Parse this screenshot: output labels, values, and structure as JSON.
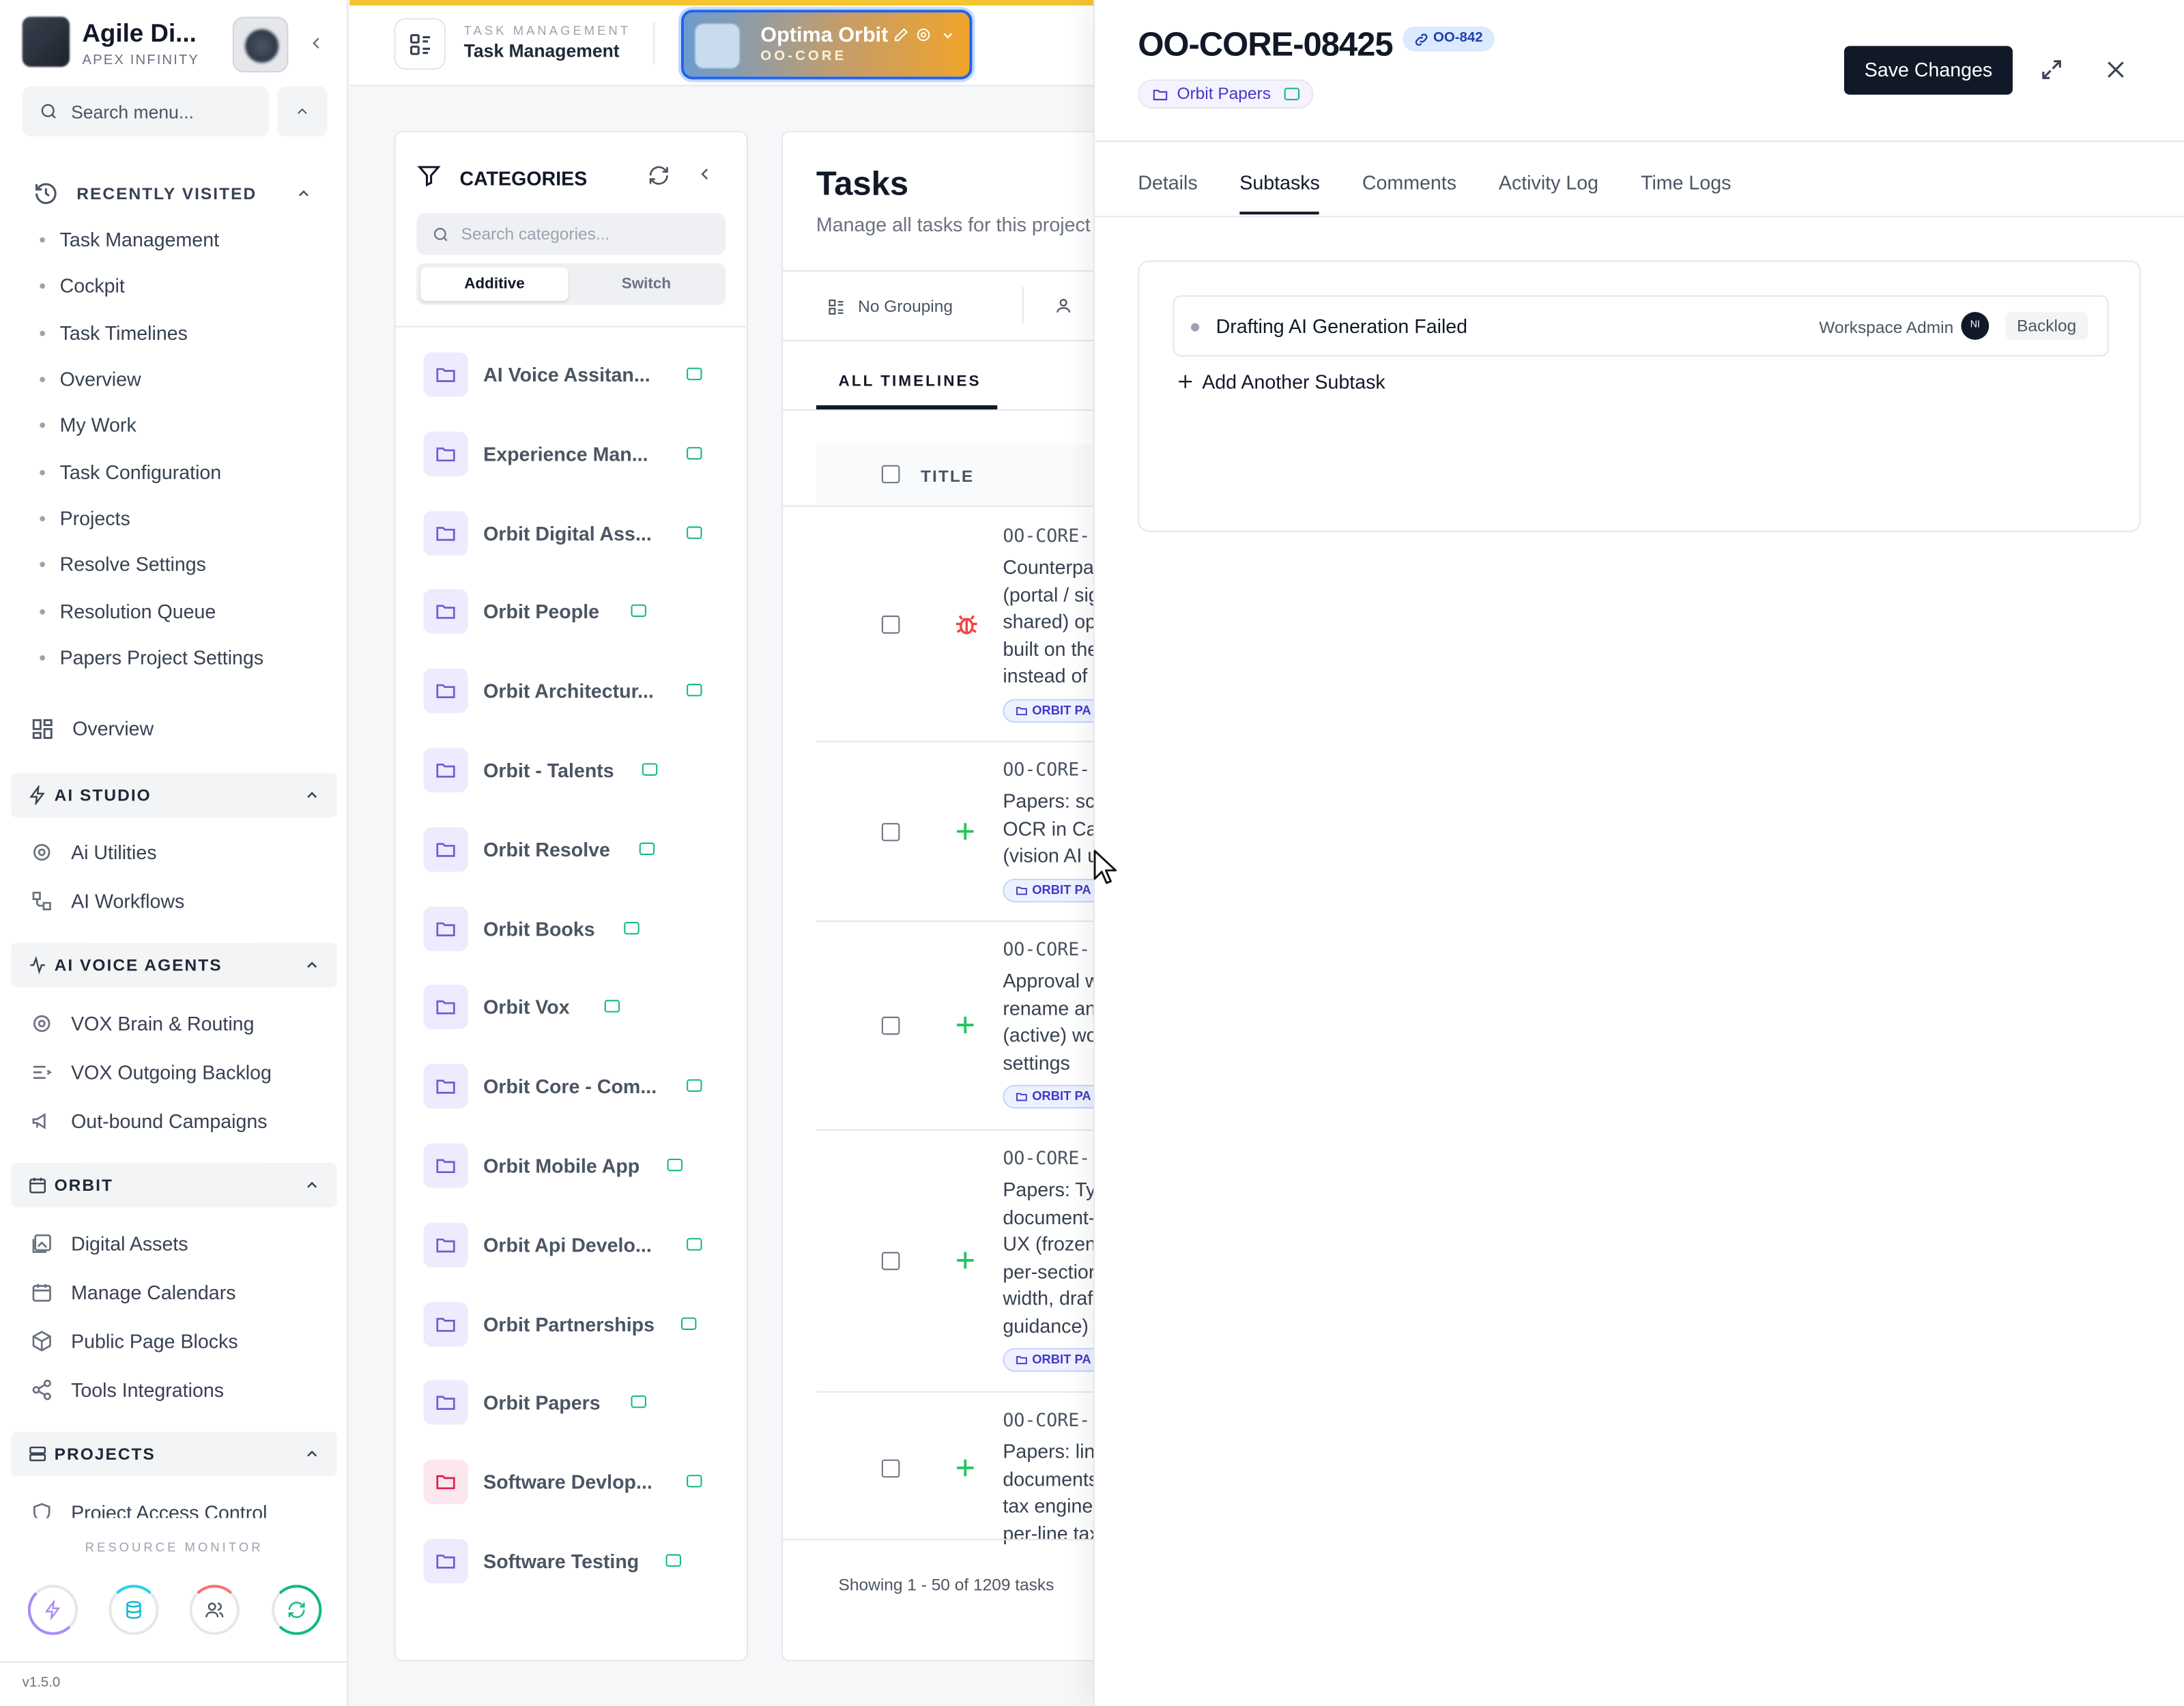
{
  "sidebar": {
    "app_title": "Agile Di...",
    "app_subtitle": "APEX INFINITY",
    "search_placeholder": "Search menu...",
    "recently_visited": {
      "label": "RECENTLY VISITED",
      "items": [
        "Task Management",
        "Cockpit",
        "Task Timelines",
        "Overview",
        "My Work",
        "Task Configuration",
        "Projects",
        "Resolve Settings",
        "Resolution Queue",
        "Papers Project Settings"
      ]
    },
    "overview_label": "Overview",
    "groups": [
      {
        "label": "AI STUDIO",
        "items": [
          {
            "label": "Ai Utilities",
            "icon": "gear-icon"
          },
          {
            "label": "AI Workflows",
            "icon": "workflow-icon"
          }
        ]
      },
      {
        "label": "AI VOICE AGENTS",
        "items": [
          {
            "label": "VOX Brain & Routing",
            "icon": "gear-icon"
          },
          {
            "label": "VOX Outgoing Backlog",
            "icon": "list-icon"
          },
          {
            "label": "Out-bound Campaigns",
            "icon": "megaphone-icon"
          }
        ]
      },
      {
        "label": "ORBIT",
        "items": [
          {
            "label": "Digital Assets",
            "icon": "image-icon"
          },
          {
            "label": "Manage Calendars",
            "icon": "calendar-icon"
          },
          {
            "label": "Public Page Blocks",
            "icon": "cube-icon"
          },
          {
            "label": "Tools Integrations",
            "icon": "share-icon"
          }
        ]
      },
      {
        "label": "PROJECTS",
        "items": [
          {
            "label": "Project Access Control",
            "icon": "shield-icon"
          }
        ]
      }
    ],
    "resource_monitor_label": "RESOURCE MONITOR",
    "version": "v1.5.0"
  },
  "header": {
    "section_small": "TASK MANAGEMENT",
    "section_title": "Task Management",
    "project_name": "Optima Orbit",
    "project_code": "OO-CORE"
  },
  "categories": {
    "title": "CATEGORIES",
    "search_placeholder": "Search categories...",
    "mode_additive": "Additive",
    "mode_switch": "Switch",
    "items": [
      "AI Voice Assitan...",
      "Experience Man...",
      "Orbit Digital Ass...",
      "Orbit People",
      "Orbit Architectur...",
      "Orbit - Talents",
      "Orbit Resolve",
      "Orbit Books",
      "Orbit Vox",
      "Orbit Core - Com...",
      "Orbit Mobile App",
      "Orbit Api Develo...",
      "Orbit Partnerships",
      "Orbit Papers",
      "Software Devlop...",
      "Software Testing"
    ]
  },
  "tasks": {
    "title": "Tasks",
    "subtitle": "Manage all tasks for this project",
    "grouping": "No Grouping",
    "timelines_tab": "ALL TIMELINES",
    "col_title": "TITLE",
    "rows": [
      {
        "id": "OO-CORE-",
        "lines": "Counterpa\n(portal / sig\nshared) op\nbuilt on the\ninstead of ",
        "chip": "ORBIT PA",
        "icon": "bug-icon"
      },
      {
        "id": "OO-CORE-",
        "lines": "Papers: sc\nOCR in Ca\n(vision AI u",
        "chip": "ORBIT PA",
        "icon": "plus-icon"
      },
      {
        "id": "OO-CORE-",
        "lines": "Approval w\nrename an\n(active) wo\nsettings",
        "chip": "ORBIT PA",
        "icon": "plus-icon"
      },
      {
        "id": "OO-CORE-",
        "lines": "Papers: Ty\ndocument-\nUX (frozen\nper-sectior\nwidth, draf\nguidance)",
        "chip": "ORBIT PA",
        "icon": "plus-icon"
      },
      {
        "id": "OO-CORE-",
        "lines": "Papers: lin\ndocuments\ntax engine\nper-line tax",
        "chip": "",
        "icon": "plus-icon"
      }
    ],
    "footer": "Showing 1 - 50 of 1209 tasks"
  },
  "drawer": {
    "task_id": "OO-CORE-08425",
    "link_badge": "OO-842",
    "category": "Orbit Papers",
    "save_label": "Save Changes",
    "tabs": [
      "Details",
      "Subtasks",
      "Comments",
      "Activity Log",
      "Time Logs"
    ],
    "active_tab": "Subtasks",
    "subtask": {
      "title": "Drafting AI Generation Failed",
      "owner": "Workspace Admin",
      "avatar_initials": "NI",
      "status": "Backlog"
    },
    "add_subtask_label": "Add Another Subtask"
  }
}
